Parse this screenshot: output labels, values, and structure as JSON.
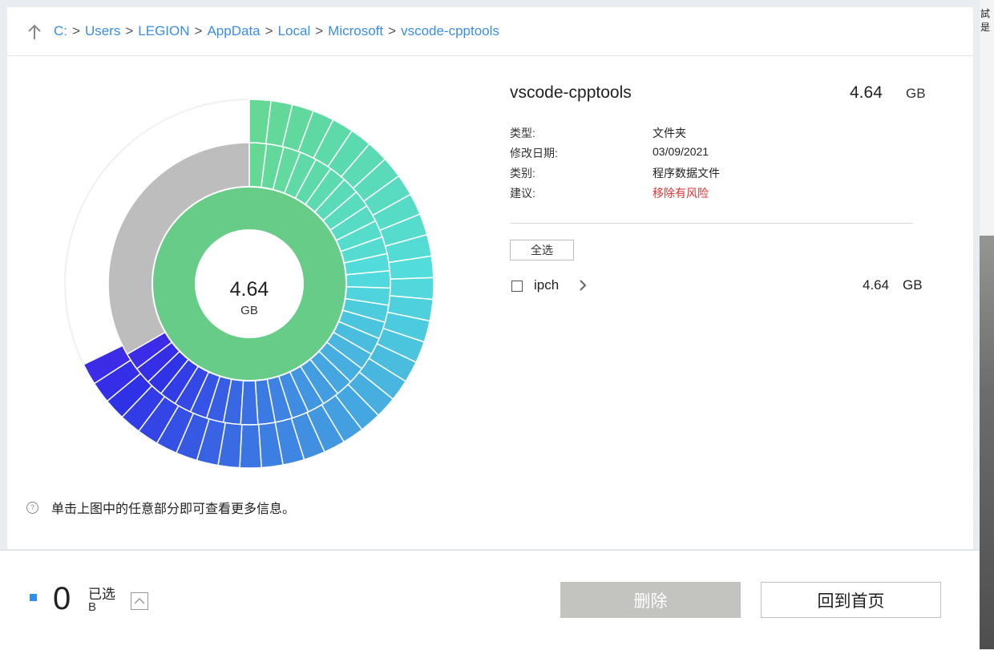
{
  "breadcrumb": {
    "items": [
      "C:",
      "Users",
      "LEGION",
      "AppData",
      "Local",
      "Microsoft",
      "vscode-cpptools"
    ],
    "separator": ">"
  },
  "chart": {
    "center_value": "4.64",
    "center_unit": "GB"
  },
  "hint": {
    "icon": "question-icon",
    "text": "单击上图中的任意部分即可查看更多信息。"
  },
  "detail": {
    "name": "vscode-cpptools",
    "size": "4.64",
    "unit": "GB",
    "properties": [
      {
        "label": "类型:",
        "value": "文件夹"
      },
      {
        "label": "修改日期:",
        "value": "03/09/2021"
      },
      {
        "label": "类别:",
        "value": "程序数据文件"
      },
      {
        "label": "建议:",
        "value": "移除有风险"
      }
    ],
    "select_all": "全选",
    "items": [
      {
        "name": "ipch",
        "size": "4.64",
        "unit": "GB"
      }
    ]
  },
  "footer": {
    "count": "0",
    "label": "已选",
    "unit": "B",
    "delete_label": "删除",
    "home_label": "回到首页"
  },
  "right_edge_text": "試是",
  "colors": {
    "link": "#3b8ee6",
    "risk": "#dd3333",
    "accent": "#2f8ff0",
    "ring_inner": "#66cc88",
    "ring_free": "#bbbbbb",
    "delete_bg": "#c3c3c0"
  }
}
